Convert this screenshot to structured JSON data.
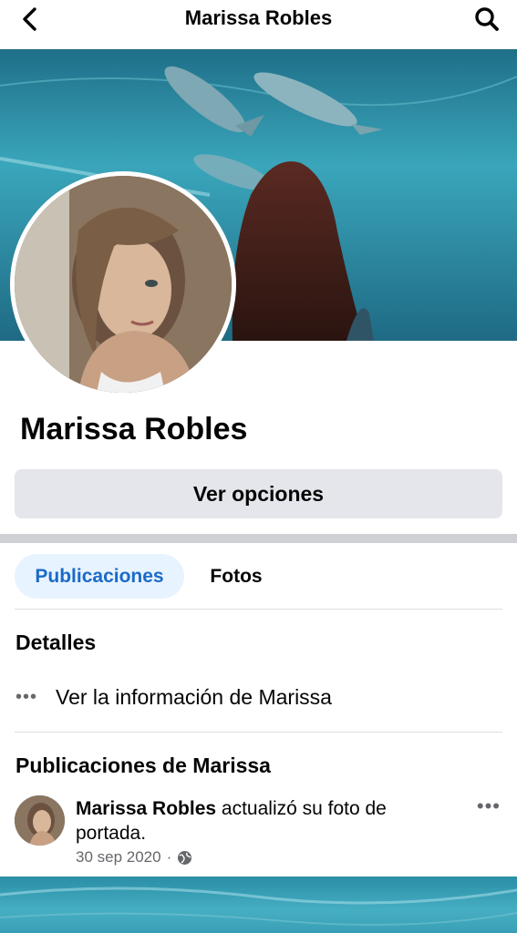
{
  "header": {
    "title": "Marissa Robles",
    "back_icon": "chevron-left-icon",
    "search_icon": "search-icon"
  },
  "profile": {
    "name": "Marissa Robles",
    "options_label": "Ver opciones"
  },
  "tabs": [
    {
      "label": "Publicaciones",
      "active": true
    },
    {
      "label": "Fotos",
      "active": false
    }
  ],
  "details": {
    "title": "Detalles",
    "info_label": "Ver la información de Marissa"
  },
  "posts_section": {
    "title": "Publicaciones de Marissa"
  },
  "post": {
    "author": "Marissa Robles",
    "action": " actualizó su foto de portada.",
    "date": "30 sep 2020",
    "separator": "·",
    "privacy_icon": "globe-icon"
  },
  "colors": {
    "accent": "#1b6ac9",
    "active_tab_bg": "#e7f3ff",
    "button_bg": "#e4e6eb",
    "secondary_text": "#65676b"
  }
}
